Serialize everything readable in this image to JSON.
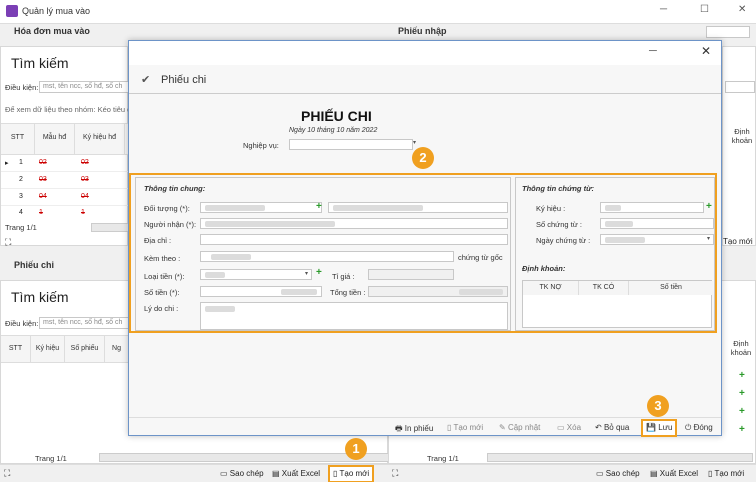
{
  "app": {
    "title": "Quản lý mua vào",
    "controls": [
      "─",
      "☐",
      "✕"
    ]
  },
  "left_top": {
    "section_title": "Hóa đơn mua vào",
    "search_title": "Tìm kiếm",
    "condition_label": "Điều kiện:",
    "condition_placeholder": "mst, tên ncc, số hđ, số ch",
    "group_hint": "Để xem dữ liệu theo nhóm: Kéo tiêu đ",
    "columns": [
      "STT",
      "Mẫu hđ",
      "Ký hiệu hđ"
    ],
    "rows": [
      {
        "stt": "1",
        "mau": "02",
        "kyhieu": "02"
      },
      {
        "stt": "2",
        "mau": "03",
        "kyhieu": "03"
      },
      {
        "stt": "3",
        "mau": "04",
        "kyhieu": "04"
      },
      {
        "stt": "4",
        "mau": "1",
        "kyhieu": "1"
      }
    ],
    "row_marker": "▸",
    "page": "Trang 1/1"
  },
  "right_top": {
    "section_title": "Phiếu nhập",
    "col_dinh_khoan": "Định khoản",
    "tao_moi": "Tạo mới"
  },
  "left_bottom": {
    "section_title": "Phiếu chi",
    "search_title": "Tìm kiếm",
    "condition_label": "Điều kiện:",
    "condition_placeholder": "mst, tên ncc, số hđ, số ch",
    "columns": [
      "STT",
      "Ký hiệu",
      "Số phiếu",
      "Ng"
    ],
    "page": "Trang 1/1",
    "btn_copy": "Sao chép",
    "btn_export": "Xuất Excel",
    "btn_new": "Tạo mới"
  },
  "right_bottom": {
    "col_dinh_khoan": "Định khoản",
    "page": "Trang 1/1",
    "btn_copy": "Sao chép",
    "btn_export": "Xuất Excel",
    "btn_new": "Tạo mới"
  },
  "dialog": {
    "header": "Phiếu chi",
    "title": "PHIẾU CHI",
    "date": "Ngày 10 tháng 10 năm 2022",
    "nghiep_vu_label": "Nghiệp vụ:",
    "general": {
      "title": "Thông tin chung:",
      "doi_tuong": "Đối tượng (*):",
      "nguoi_nhan": "Người nhận (*):",
      "dia_chi": "Địa chỉ :",
      "kem_theo": "Kèm theo :",
      "chung_tu_goc": "chứng từ gốc",
      "loai_tien": "Loại tiền (*):",
      "ti_gia": "Tỉ giá :",
      "so_tien": "Số tiền (*):",
      "tong_tien": "Tổng tiền :",
      "ly_do_chi": "Lý do chi :"
    },
    "voucher": {
      "title": "Thông tin chứng từ:",
      "ky_hieu": "Ký hiệu :",
      "so_chung_tu": "Số chứng từ :",
      "ngay_chung_tu": "Ngày chứng từ :"
    },
    "accounting": {
      "title": "Định khoản:",
      "columns": [
        "TK NỢ",
        "TK CÓ",
        "Số tiền"
      ]
    },
    "toolbar": {
      "in_phieu": "In phiếu",
      "tao_moi": "Tạo mới",
      "cap_nhat": "Cập nhật",
      "xoa": "Xóa",
      "bo_qua": "Bỏ qua",
      "luu": "Lưu",
      "dong": "Đóng"
    }
  },
  "callouts": [
    "1",
    "2",
    "3"
  ]
}
